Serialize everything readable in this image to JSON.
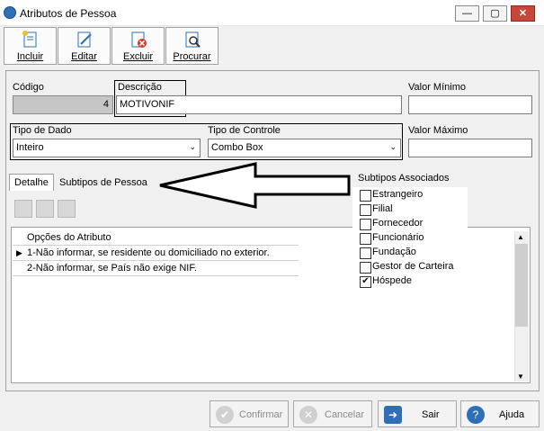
{
  "window": {
    "title": "Atributos de Pessoa",
    "minimize_label": "—",
    "maximize_label": "▢",
    "close_label": "✕"
  },
  "toolbar": {
    "incluir": "Incluir",
    "editar": "Editar",
    "excluir": "Excluir",
    "procurar": "Procurar"
  },
  "form": {
    "codigo_label": "Código",
    "codigo_value": "4",
    "descricao_label": "Descrição",
    "descricao_value": "MOTIVONIF",
    "valor_minimo_label": "Valor Mínimo",
    "valor_minimo_value": "",
    "tipo_dado_label": "Tipo de Dado",
    "tipo_dado_value": "Inteiro",
    "tipo_controle_label": "Tipo de Controle",
    "tipo_controle_value": "Combo Box",
    "valor_maximo_label": "Valor Máximo",
    "valor_maximo_value": ""
  },
  "tabs": {
    "detalhe": "Detalhe",
    "subtipos": "Subtipos de Pessoa"
  },
  "subtipos": {
    "title": "Subtipos Associados",
    "items": [
      {
        "label": "Estrangeiro",
        "checked": ""
      },
      {
        "label": "Filial",
        "checked": ""
      },
      {
        "label": "Fornecedor",
        "checked": ""
      },
      {
        "label": "Funcionário",
        "checked": ""
      },
      {
        "label": "Fundação",
        "checked": ""
      },
      {
        "label": "Gestor de Carteira",
        "checked": ""
      },
      {
        "label": "Hóspede",
        "checked": "✔"
      }
    ]
  },
  "grid": {
    "header": "Opções do Atributo",
    "rows": [
      "1-Não informar, se residente ou domiciliado no exterior.",
      "2-Não informar, se País não exige NIF."
    ],
    "row_indicator": "▶",
    "scroll_up": "▲",
    "scroll_down": "▼"
  },
  "footer": {
    "confirmar": "Confirmar",
    "cancelar": "Cancelar",
    "sair": "Sair",
    "ajuda": "Ajuda"
  },
  "colors": {
    "accent": "#2d6fb8",
    "close": "#c9473a",
    "disabled_text": "#8a8a8a"
  },
  "icons": {
    "confirm": "check-icon",
    "cancel": "x-circle-icon",
    "exit": "exit-door-icon",
    "help": "help-icon"
  }
}
